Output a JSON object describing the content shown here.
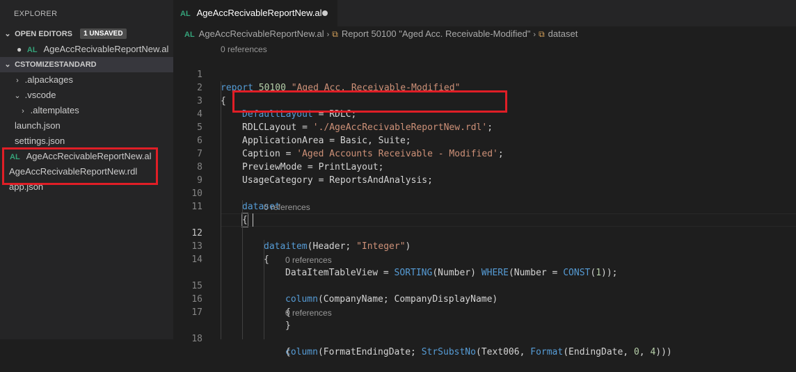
{
  "explorer": {
    "title": "EXPLORER",
    "open_editors": {
      "label": "OPEN EDITORS",
      "badge": "1 UNSAVED",
      "file": "AgeAccRecivableReportNew.al",
      "file_icon": "AL"
    },
    "workspace": {
      "label": "CSTOMIZESTANDARD",
      "items": [
        {
          "name": ".alpackages",
          "type": "folder-collapsed"
        },
        {
          "name": ".vscode",
          "type": "folder-expanded"
        },
        {
          "name": ".altemplates",
          "type": "folder-collapsed"
        },
        {
          "name": "launch.json",
          "type": "file"
        },
        {
          "name": "settings.json",
          "type": "file"
        },
        {
          "name": "AgeAccRecivableReportNew.al",
          "type": "al-file",
          "icon": "AL"
        },
        {
          "name": "AgeAccRecivableReportNew.rdl",
          "type": "file"
        },
        {
          "name": "app.json",
          "type": "file"
        }
      ]
    }
  },
  "tab": {
    "icon": "AL",
    "label": "AgeAccRecivableReportNew.al",
    "unsaved": true
  },
  "breadcrumb": {
    "file": "AgeAccRecivableReportNew.al",
    "symbol": "Report 50100 \"Aged Acc. Receivable-Modified\"",
    "member": "dataset"
  },
  "editor": {
    "codelens": "0 references",
    "lines": [
      {
        "n": "1",
        "text": "report 50100 \"Aged Acc. Receivable-Modified\""
      },
      {
        "n": "2",
        "text": "{"
      },
      {
        "n": "3",
        "text": "DefaultLayout = RDLC;"
      },
      {
        "n": "4",
        "text": "RDLCLayout = './AgeAccRecivableReportNew.rdl';"
      },
      {
        "n": "5",
        "text": "ApplicationArea = Basic, Suite;"
      },
      {
        "n": "6",
        "text": "Caption = 'Aged Accounts Receivable - Modified';"
      },
      {
        "n": "7",
        "text": "PreviewMode = PrintLayout;"
      },
      {
        "n": "8",
        "text": "UsageCategory = ReportsAndAnalysis;"
      },
      {
        "n": "9",
        "text": ""
      },
      {
        "n": "10",
        "text": "dataset"
      },
      {
        "n": "11",
        "text": "{"
      },
      {
        "n": "12",
        "text": "dataitem(Header; \"Integer\")"
      },
      {
        "n": "13",
        "text": "{"
      },
      {
        "n": "14",
        "text": "DataItemTableView = SORTING(Number) WHERE(Number = CONST(1));"
      },
      {
        "n": "15",
        "text": "column(CompanyName; CompanyDisplayName)"
      },
      {
        "n": "16",
        "text": "{"
      },
      {
        "n": "17",
        "text": "}"
      },
      {
        "n": "18",
        "text": "column(FormatEndingDate; StrSubstNo(Text006, Format(EndingDate, 0, 4)))"
      }
    ]
  },
  "colors": {
    "highlight_box": "#e01e26",
    "al_icon": "#35a37a"
  }
}
